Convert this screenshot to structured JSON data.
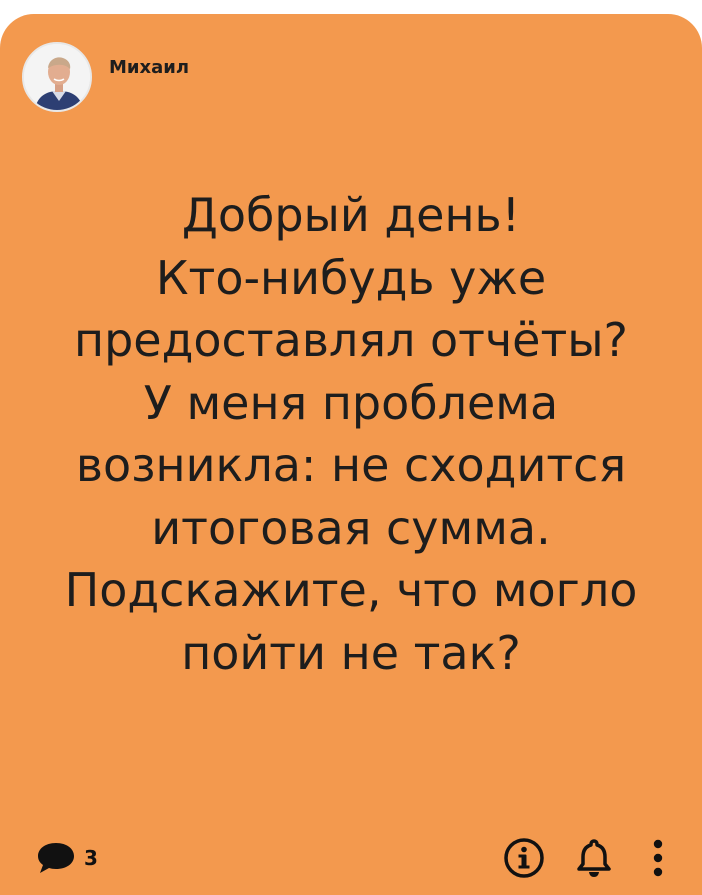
{
  "post": {
    "author": "Михаил",
    "message_lines": [
      "Добрый день!",
      "Кто-нибудь уже",
      "предоставлял отчёты?",
      "У меня проблема",
      "возникла: не сходится",
      "итоговая сумма.",
      "Подскажите, что могло",
      "пойти не так?"
    ],
    "comment_count": "3"
  },
  "icons": {
    "comment": "speech-bubble-icon",
    "info": "info-icon",
    "notify": "bell-icon",
    "more": "more-vertical-icon"
  },
  "colors": {
    "card_background": "#f3994e",
    "text": "#1d1d1d"
  }
}
